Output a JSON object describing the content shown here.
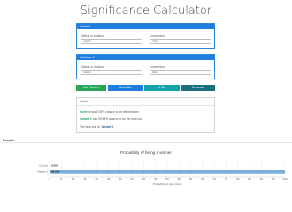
{
  "app": {
    "title": "Significance Calculator"
  },
  "control": {
    "header": "Control",
    "visitors_label": "Visitors or sessions",
    "visitors_value": "15000",
    "conversions_label": "Conversions",
    "conversions_value": "2000"
  },
  "variation": {
    "header": "Variation 1",
    "visitors_label": "Visitors or sessions",
    "visitors_value": "15000",
    "conversions_label": "Conversions",
    "conversions_value": "2300"
  },
  "buttons": {
    "add_variant": "Add Variant",
    "calculate": "Calculate",
    "one_tail": "1 Tail",
    "separator": "Separate"
  },
  "results": {
    "header": "Verdict",
    "control_name": "Control",
    "control_text": "has 0.00% chance to be the best one.",
    "variant_name": "Variant 1",
    "variant_text": "has 99.99% chance to be the best one.",
    "best_prefix": "The best one is:",
    "best_name": "Variant 1"
  },
  "section": {
    "label": "Results"
  },
  "chart_data": {
    "type": "bar",
    "orientation": "horizontal",
    "title": "Probability of being a winner",
    "xlabel": "Probability of performing",
    "categories": [
      "Control",
      "Variant 1"
    ],
    "values": [
      0.0,
      99.99
    ],
    "value_labels": [
      "0.000",
      "99.999"
    ],
    "xlim": [
      0,
      100
    ],
    "xticks": [
      0,
      5,
      10,
      15,
      20,
      25,
      30,
      35,
      40,
      45,
      50,
      55,
      60,
      65,
      70,
      75,
      80,
      85,
      90,
      95,
      100
    ],
    "grid": true,
    "colors": {
      "bar": "#7baedb",
      "accent": "#1e7fe0",
      "success": "#27a55a",
      "teal": "#13a3ad",
      "dark_teal": "#16707e"
    }
  }
}
